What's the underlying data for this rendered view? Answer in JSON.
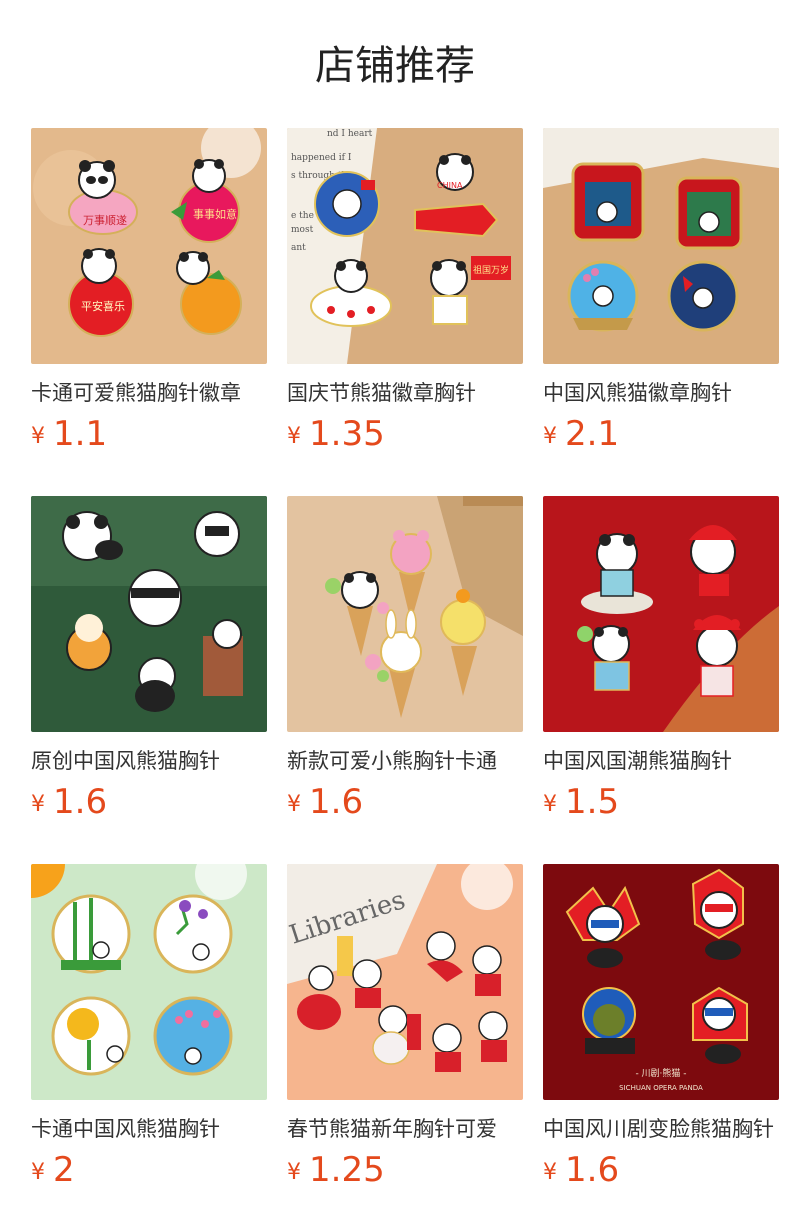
{
  "title": "店铺推荐",
  "colors": {
    "price": "#e4491c",
    "title": "#222222",
    "text": "#333333"
  },
  "products": [
    {
      "name": "卡通可爱熊猫胸针徽章",
      "currency": "¥",
      "price": "1.1",
      "image": "four cute panda pins on tan sand background"
    },
    {
      "name": "国庆节熊猫徽章胸针",
      "currency": "¥",
      "price": "1.35",
      "image": "national day panda pins with flags and rockets"
    },
    {
      "name": "中国风熊猫徽章胸针",
      "currency": "¥",
      "price": "2.1",
      "image": "chinese style panda badges red and blue frames"
    },
    {
      "name": "原创中国风熊猫胸针",
      "currency": "¥",
      "price": "1.6",
      "image": "black and white panda pins on green background"
    },
    {
      "name": "新款可爱小熊胸针卡通",
      "currency": "¥",
      "price": "1.6",
      "image": "ice cream cone animal pins on beige background"
    },
    {
      "name": "中国风国潮熊猫胸针",
      "currency": "¥",
      "price": "1.5",
      "image": "panda opera pins on red and gold background"
    },
    {
      "name": "卡通中国风熊猫胸针",
      "currency": "¥",
      "price": "2",
      "image": "round flower panda pins on pale green background"
    },
    {
      "name": "春节熊猫新年胸针可爱",
      "currency": "¥",
      "price": "1.25",
      "image": "spring festival panda pins on peach background"
    },
    {
      "name": "中国风川剧变脸熊猫胸针",
      "currency": "¥",
      "price": "1.6",
      "image": "sichuan opera face changing panda pins on dark red"
    }
  ],
  "image_caption": {
    "opera_sub1": "- 川剧·熊猫 -",
    "opera_sub2": "SICHUAN OPERA PANDA",
    "book_text": "Libraries",
    "national_flag1": "CHINA",
    "national_flag2": "祖国万岁",
    "pin_text1": "万事顺遂",
    "pin_text2": "平安喜乐",
    "pin_text3": "事事如意"
  }
}
